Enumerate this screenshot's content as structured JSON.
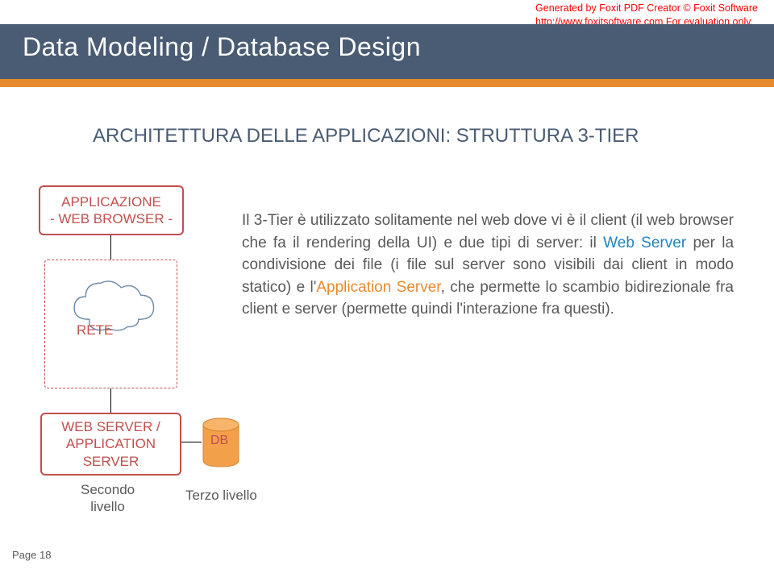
{
  "watermark": {
    "line1": "Generated by Foxit PDF Creator © Foxit Software",
    "line2": "http://www.foxitsoftware.com   For evaluation only."
  },
  "title": "Data Modeling / Database Design",
  "subtitle": "ARCHITETTURA DELLE APPLICAZIONI: STRUTTURA 3-TIER",
  "diagram": {
    "appbox_line1": "APPLICAZIONE",
    "appbox_line2": "- WEB BROWSER -",
    "cloud_label": "RETE",
    "server_line1": "WEB SERVER /",
    "server_line2": "APPLICATION",
    "server_line3": "SERVER",
    "secondo_line1": "Secondo",
    "secondo_line2": "livello",
    "db_label": "DB",
    "terzo": "Terzo livello"
  },
  "body": {
    "t1": "Il 3-Tier è utilizzato solitamente nel web dove vi è il client (il web browser che fa il rendering della UI) e due tipi di server: il ",
    "web": "Web Server",
    "t2": " per la condivisione dei file (i file sul server sono visibili dai client in modo statico) e l'",
    "app": "Application Server",
    "t3": ", che permette lo scambio bidirezionale fra client e server (permette quindi l'interazione fra questi)."
  },
  "page_footer": "Page 18"
}
